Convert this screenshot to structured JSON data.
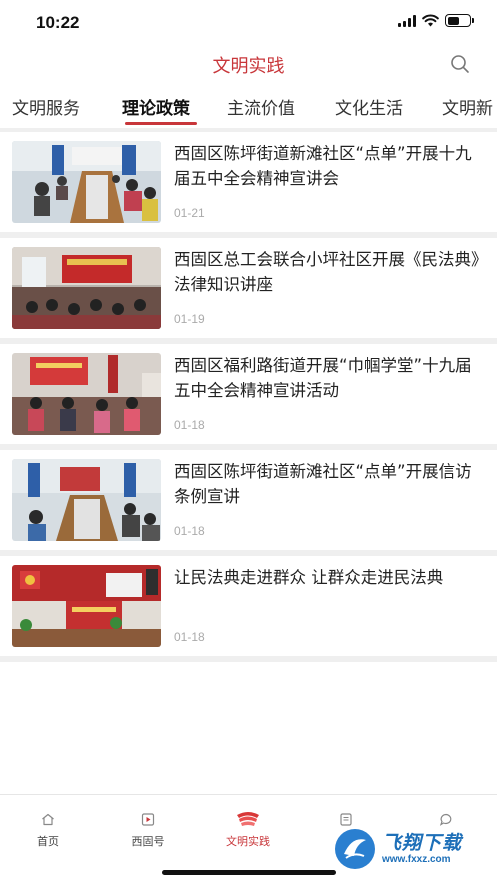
{
  "status_bar": {
    "time": "10:22"
  },
  "header": {
    "title": "文明实践"
  },
  "tabs": [
    {
      "label": "文明服务"
    },
    {
      "label": "理论政策",
      "active": true
    },
    {
      "label": "主流价值"
    },
    {
      "label": "文化生活"
    },
    {
      "label": "文明新"
    }
  ],
  "news": [
    {
      "title": "西固区陈坪街道新滩社区“点单”开展十九届五中全会精神宣讲会",
      "date": "01-21"
    },
    {
      "title": "西固区总工会联合小坪社区开展《民法典》法律知识讲座",
      "date": "01-19"
    },
    {
      "title": "西固区福利路街道开展“巾帼学堂”十九届五中全会精神宣讲活动",
      "date": "01-18"
    },
    {
      "title": "西固区陈坪街道新滩社区“点单”开展信访条例宣讲",
      "date": "01-18"
    },
    {
      "title": "让民法典走进群众 让群众走进民法典",
      "date": "01-18"
    }
  ],
  "bottom_nav": [
    {
      "label": "首页",
      "icon": "home-icon"
    },
    {
      "label": "西固号",
      "icon": "play-icon"
    },
    {
      "label": "文明实践",
      "icon": "practice-icon",
      "active": true
    },
    {
      "label": "",
      "icon": "document-icon"
    },
    {
      "label": "",
      "icon": "chat-icon"
    }
  ],
  "watermark": {
    "text": "飞翔下载",
    "url": "www.fxxz.com"
  },
  "colors": {
    "accent": "#c8363a",
    "separator": "#efefef"
  }
}
